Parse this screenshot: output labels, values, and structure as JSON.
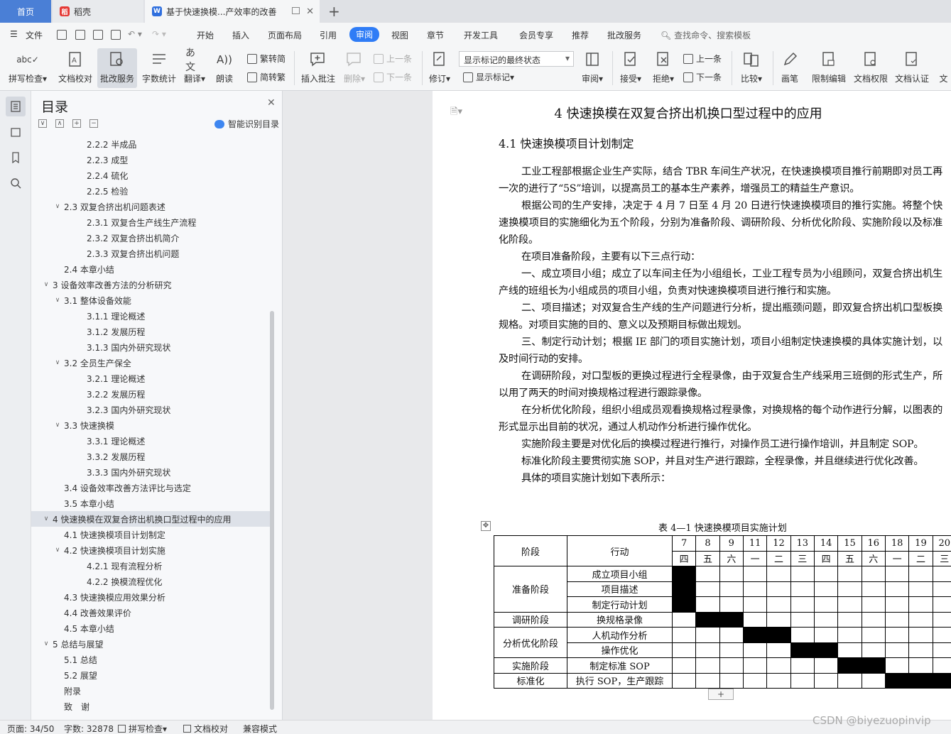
{
  "tabs": {
    "home": "首页",
    "daoke": "稻壳",
    "doc": "基于快速换模...产效率的改善"
  },
  "menu": [
    "文件",
    "开始",
    "插入",
    "页面布局",
    "引用",
    "审阅",
    "视图",
    "章节",
    "开发工具",
    "会员专享",
    "推荐",
    "批改服务"
  ],
  "menu_active": "审阅",
  "search_placeholder": "查找命令、搜索模板",
  "toolbar": {
    "spellcheck": "拼写检查",
    "doc_proof": "文档校对",
    "correction_service": "批改服务",
    "word_count": "字数统计",
    "translate": "翻译",
    "read_aloud": "朗读",
    "to_traditional": "繁转简",
    "to_simplified": "简转繁",
    "insert_comment": "插入批注",
    "delete": "删除",
    "prev_comment": "上一条",
    "next_comment": "下一条",
    "revise": "修订",
    "markup_select": "显示标记的最终状态",
    "show_markup": "显示标记",
    "review": "审阅",
    "accept": "接受",
    "reject": "拒绝",
    "prev_change": "上一条",
    "next_change": "下一条",
    "compare": "比较",
    "pen": "画笔",
    "restrict_edit": "限制编辑",
    "doc_permission": "文档权限",
    "doc_cert": "文档认证",
    "doc_more": "文"
  },
  "toc": {
    "title": "目录",
    "smart": "智能识别目录",
    "items": [
      {
        "level": 3,
        "text": "2.2.2  半成品",
        "arrow": ""
      },
      {
        "level": 3,
        "text": "2.2.3  成型",
        "arrow": ""
      },
      {
        "level": 3,
        "text": "2.2.4  硫化",
        "arrow": ""
      },
      {
        "level": 3,
        "text": "2.2.5  检验",
        "arrow": ""
      },
      {
        "level": 2,
        "text": "2.3  双复合挤出机问题表述",
        "arrow": "∨"
      },
      {
        "level": 3,
        "text": "2.3.1  双复合生产线生产流程",
        "arrow": ""
      },
      {
        "level": 3,
        "text": "2.3.2  双复合挤出机简介",
        "arrow": ""
      },
      {
        "level": 3,
        "text": "2.3.3  双复合挤出机问题",
        "arrow": ""
      },
      {
        "level": 2,
        "text": "2.4  本章小结",
        "arrow": ""
      },
      {
        "level": 1,
        "text": "3  设备效率改善方法的分析研究",
        "arrow": "∨"
      },
      {
        "level": 2,
        "text": "3.1  整体设备效能",
        "arrow": "∨"
      },
      {
        "level": 3,
        "text": "3.1.1  理论概述",
        "arrow": ""
      },
      {
        "level": 3,
        "text": "3.1.2  发展历程",
        "arrow": ""
      },
      {
        "level": 3,
        "text": "3.1.3  国内外研究现状",
        "arrow": ""
      },
      {
        "level": 2,
        "text": "3.2  全员生产保全",
        "arrow": "∨"
      },
      {
        "level": 3,
        "text": "3.2.1  理论概述",
        "arrow": ""
      },
      {
        "level": 3,
        "text": "3.2.2  发展历程",
        "arrow": ""
      },
      {
        "level": 3,
        "text": "3.2.3  国内外研究现状",
        "arrow": ""
      },
      {
        "level": 2,
        "text": "3.3  快速换模",
        "arrow": "∨"
      },
      {
        "level": 3,
        "text": "3.3.1  理论概述",
        "arrow": ""
      },
      {
        "level": 3,
        "text": "3.3.2  发展历程",
        "arrow": ""
      },
      {
        "level": 3,
        "text": "3.3.3  国内外研究现状",
        "arrow": ""
      },
      {
        "level": 2,
        "text": "3.4  设备效率改善方法评比与选定",
        "arrow": ""
      },
      {
        "level": 2,
        "text": "3.5  本章小结",
        "arrow": ""
      },
      {
        "level": 1,
        "text": "4  快速换模在双复合挤出机换口型过程中的应用",
        "arrow": "∨",
        "selected": true
      },
      {
        "level": 2,
        "text": "4.1  快速换模项目计划制定",
        "arrow": ""
      },
      {
        "level": 2,
        "text": "4.2  快速换模项目计划实施",
        "arrow": "∨"
      },
      {
        "level": 3,
        "text": "4.2.1  现有流程分析",
        "arrow": ""
      },
      {
        "level": 3,
        "text": "4.2.2  换模流程优化",
        "arrow": ""
      },
      {
        "level": 2,
        "text": "4.3  快速换模应用效果分析",
        "arrow": ""
      },
      {
        "level": 2,
        "text": "4.4  改善效果评价",
        "arrow": ""
      },
      {
        "level": 2,
        "text": "4.5  本章小结",
        "arrow": ""
      },
      {
        "level": 1,
        "text": "5  总结与展望",
        "arrow": "∨"
      },
      {
        "level": 2,
        "text": "5.1  总结",
        "arrow": ""
      },
      {
        "level": 2,
        "text": "5.2  展望",
        "arrow": ""
      },
      {
        "level": 0,
        "text": "附录",
        "arrow": ""
      },
      {
        "level": 0,
        "text": "致　谢",
        "arrow": ""
      }
    ]
  },
  "document": {
    "heading1": "4  快速换模在双复合挤出机换口型过程中的应用",
    "heading2": "4.1  快速换模项目计划制定",
    "paragraphs": [
      "工业工程部根据企业生产实际，结合 TBR 车间生产状况，在快速换模项目推行前期即对员工再一次的进行了“5S”培训，以提高员工的基本生产素养，增强员工的精益生产意识。",
      "根据公司的生产安排，决定于 4 月 7 日至 4 月 20 日进行快速换模项目的推行实施。将整个快速换模项目的实施细化为五个阶段，分别为准备阶段、调研阶段、分析优化阶段、实施阶段以及标准化阶段。",
      "在项目准备阶段，主要有以下三点行动：",
      "一、成立项目小组；成立了以车间主任为小组组长，工业工程专员为小组顾问，双复合挤出机生产线的班组长为小组成员的项目小组，负责对快速换模项目进行推行和实施。",
      "二、项目描述；对双复合生产线的生产问题进行分析，提出瓶颈问题，即双复合挤出机口型板换规格。对项目实施的目的、意义以及预期目标做出规划。",
      "三、制定行动计划；根据 IE 部门的项目实施计划，项目小组制定快速换模的具体实施计划，以及时间行动的安排。",
      "在调研阶段，对口型板的更换过程进行全程录像，由于双复合生产线采用三班倒的形式生产，所以用了两天的时间对换规格过程进行跟踪录像。",
      "在分析优化阶段，组织小组成员观看换规格过程录像，对换规格的每个动作进行分解，以图表的形式显示出目前的状况，通过人机动作分析进行操作优化。",
      "实施阶段主要是对优化后的换模过程进行推行，对操作员工进行操作培训，并且制定 SOP。",
      "标准化阶段主要贯彻实施 SOP，并且对生产进行跟踪，全程录像，并且继续进行优化改善。",
      "具体的项目实施计划如下表所示："
    ],
    "table_caption": "表 4—1  快速换模项目实施计划",
    "table": {
      "col_stage": "阶段",
      "col_action": "行动",
      "days": [
        "7",
        "8",
        "9",
        "11",
        "12",
        "13",
        "14",
        "15",
        "16",
        "18",
        "19",
        "20"
      ],
      "weekdays": [
        "四",
        "五",
        "六",
        "一",
        "二",
        "三",
        "四",
        "五",
        "六",
        "一",
        "二",
        "三"
      ],
      "stages": [
        {
          "name": "准备阶段",
          "actions": [
            {
              "name": "成立项目小组",
              "filled": [
                0
              ]
            },
            {
              "name": "项目描述",
              "filled": [
                0
              ]
            },
            {
              "name": "制定行动计划",
              "filled": [
                0
              ]
            }
          ]
        },
        {
          "name": "调研阶段",
          "actions": [
            {
              "name": "换规格录像",
              "filled": [
                1,
                2
              ]
            }
          ]
        },
        {
          "name": "分析优化阶段",
          "actions": [
            {
              "name": "人机动作分析",
              "filled": [
                3,
                4
              ]
            },
            {
              "name": "操作优化",
              "filled": [
                5,
                6
              ]
            }
          ]
        },
        {
          "name": "实施阶段",
          "actions": [
            {
              "name": "制定标准 SOP",
              "filled": [
                7,
                8
              ]
            }
          ]
        },
        {
          "name": "标准化",
          "actions": [
            {
              "name": "执行 SOP，生产跟踪",
              "filled": [
                9,
                10,
                11
              ]
            }
          ]
        }
      ]
    }
  },
  "status": {
    "page": "页面: 34/50",
    "words": "字数: 32878",
    "spell": "拼写检查",
    "proof": "文档校对",
    "compat": "兼容模式"
  },
  "watermark": "CSDN @biyezuopinvip"
}
